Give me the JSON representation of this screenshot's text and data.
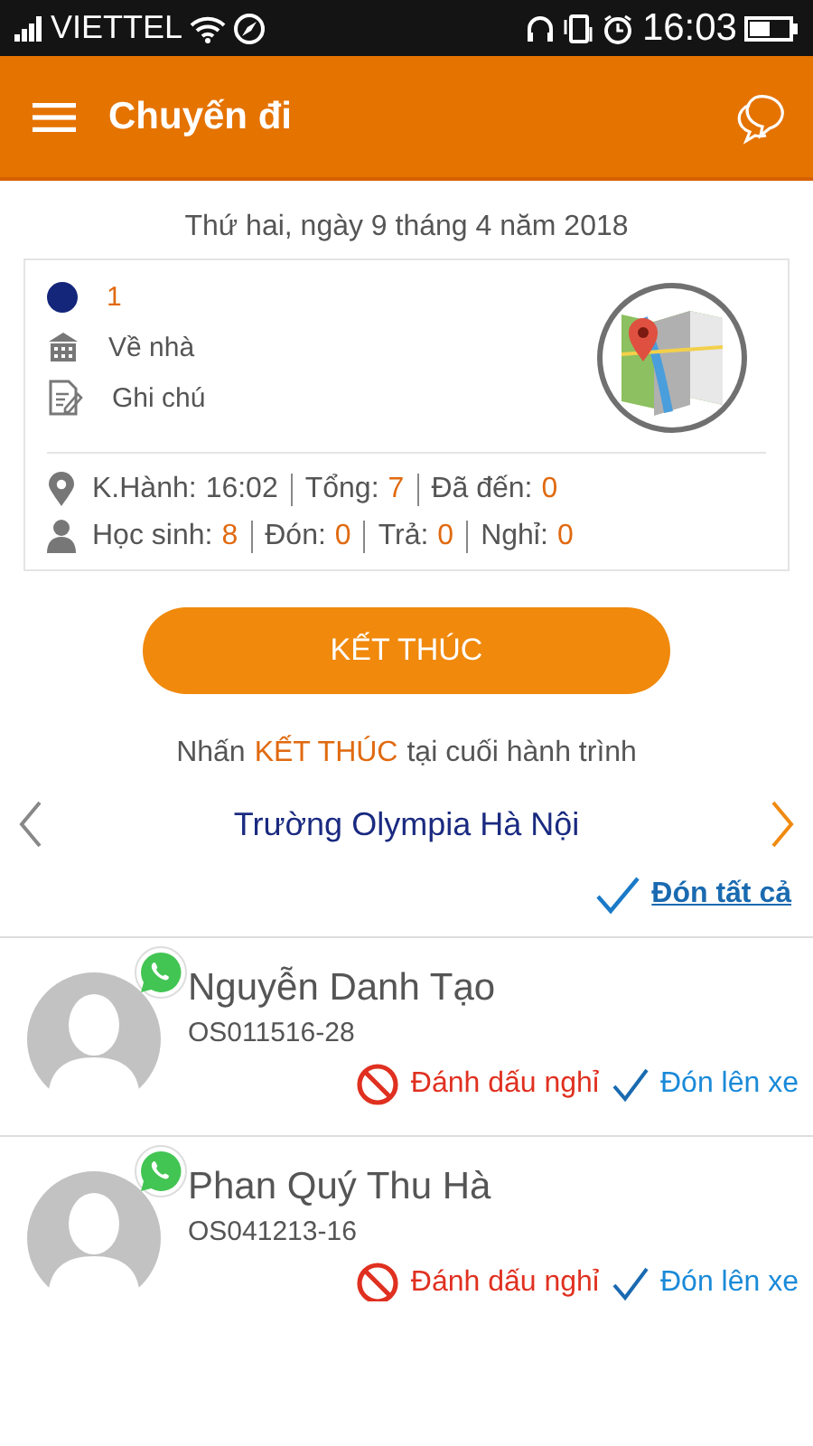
{
  "status_bar": {
    "carrier": "VIETTEL",
    "time": "16:03"
  },
  "app_bar": {
    "title": "Chuyến đi"
  },
  "date": "Thứ hai, ngày 9 tháng 4 năm 2018",
  "trip": {
    "number": "1",
    "color": "#14267a",
    "direction": "Về nhà",
    "note": "Ghi chú",
    "stats": [
      [
        {
          "label": "K.Hành:",
          "value": "16:02",
          "kind": "time"
        },
        {
          "label": "Tổng:",
          "value": "7",
          "kind": "count"
        },
        {
          "label": "Đã đến:",
          "value": "0",
          "kind": "count"
        }
      ],
      [
        {
          "label": "Học sinh:",
          "value": "8",
          "kind": "count"
        },
        {
          "label": "Đón:",
          "value": "0",
          "kind": "count"
        },
        {
          "label": "Trả:",
          "value": "0",
          "kind": "count"
        },
        {
          "label": "Nghỉ:",
          "value": "0",
          "kind": "count"
        }
      ]
    ]
  },
  "end_button": "KẾT THÚC",
  "hint": {
    "before": "Nhấn",
    "highlight": "KẾT THÚC",
    "after": "tại cuối hành trình"
  },
  "school": "Trường Olympia Hà Nội",
  "pick_all": "Đón tất cả",
  "students": [
    {
      "name": "Nguyễn Danh Tạo",
      "code": "OS011516-28",
      "absent_action": "Đánh dấu nghỉ",
      "pickup_action": "Đón lên xe"
    },
    {
      "name": "Phan Quý Thu Hà",
      "code": "OS041213-16",
      "absent_action": "Đánh dấu nghỉ",
      "pickup_action": "Đón lên xe"
    }
  ]
}
